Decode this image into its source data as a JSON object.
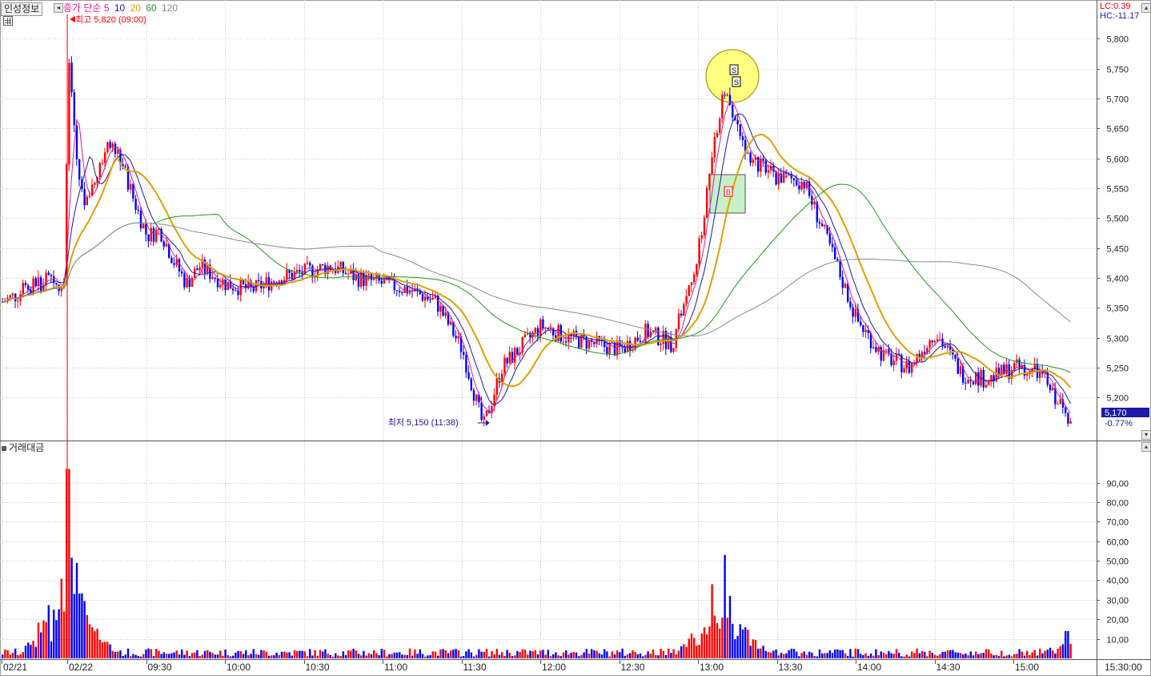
{
  "header": {
    "tab_label": "인성정보",
    "ma_title": "종가 단순",
    "ma_periods": [
      "5",
      "10",
      "20",
      "60",
      "120"
    ],
    "ma_colors": [
      "#e01a9a",
      "#1a1aa8",
      "#e0a000",
      "#1a9a1a",
      "#8a8a8a"
    ]
  },
  "annotations": {
    "high": "최고 5,820 (09:00)",
    "low": "최저 5,150 (11:38)",
    "lc": "LC:0.39",
    "hc": "HC:-11.17",
    "current_price": "5,170",
    "current_change": "-0.77%",
    "signals": [
      "S",
      "S",
      "B"
    ]
  },
  "volume_panel": {
    "title": "거래대금"
  },
  "colors": {
    "up": "#ff0000",
    "down": "#0000ff",
    "grid": "#c8c8c8",
    "signal_circle": "#ffff80",
    "signal_box": "#c8f0c8"
  },
  "chart_data": [
    {
      "type": "candlestick",
      "title": "인성정보",
      "ylim": [
        5120,
        5830
      ],
      "y_ticks": [
        "5,800",
        "5,750",
        "5,700",
        "5,650",
        "5,600",
        "5,550",
        "5,500",
        "5,450",
        "5,400",
        "5,350",
        "5,300",
        "5,250",
        "5,200"
      ],
      "x_ticks": [
        "02/21",
        "02/22",
        "09:30",
        "10:00",
        "10:30",
        "11:00",
        "11:30",
        "12:00",
        "12:30",
        "13:00",
        "13:30",
        "14:00",
        "14:30",
        "15:00",
        "15:30:00"
      ],
      "price_path": [
        [
          "02/21 15:00",
          5360
        ],
        [
          "02/21 15:20",
          5395
        ],
        [
          "02/21 15:30",
          5385
        ],
        [
          "09:00",
          5820
        ],
        [
          "09:03",
          5600
        ],
        [
          "09:06",
          5520
        ],
        [
          "09:10",
          5570
        ],
        [
          "09:15",
          5630
        ],
        [
          "09:20",
          5600
        ],
        [
          "09:25",
          5530
        ],
        [
          "09:30",
          5470
        ],
        [
          "09:35",
          5480
        ],
        [
          "09:40",
          5430
        ],
        [
          "09:45",
          5390
        ],
        [
          "09:50",
          5420
        ],
        [
          "10:00",
          5390
        ],
        [
          "10:10",
          5380
        ],
        [
          "10:20",
          5400
        ],
        [
          "10:30",
          5410
        ],
        [
          "10:40",
          5420
        ],
        [
          "10:50",
          5400
        ],
        [
          "11:00",
          5390
        ],
        [
          "11:10",
          5380
        ],
        [
          "11:20",
          5360
        ],
        [
          "11:30",
          5280
        ],
        [
          "11:38",
          5150
        ],
        [
          "11:45",
          5250
        ],
        [
          "12:00",
          5320
        ],
        [
          "12:10",
          5300
        ],
        [
          "12:20",
          5290
        ],
        [
          "12:30",
          5280
        ],
        [
          "12:40",
          5310
        ],
        [
          "12:50",
          5290
        ],
        [
          "13:00",
          5450
        ],
        [
          "13:05",
          5600
        ],
        [
          "13:10",
          5720
        ],
        [
          "13:15",
          5640
        ],
        [
          "13:20",
          5600
        ],
        [
          "13:25",
          5580
        ],
        [
          "13:30",
          5570
        ],
        [
          "13:40",
          5560
        ],
        [
          "13:50",
          5450
        ],
        [
          "14:00",
          5330
        ],
        [
          "14:10",
          5270
        ],
        [
          "14:20",
          5250
        ],
        [
          "14:30",
          5310
        ],
        [
          "14:40",
          5240
        ],
        [
          "14:50",
          5230
        ],
        [
          "15:00",
          5250
        ],
        [
          "15:10",
          5240
        ],
        [
          "15:20",
          5170
        ]
      ],
      "series": [
        {
          "name": "5",
          "color": "#e01a9a"
        },
        {
          "name": "10",
          "color": "#1a1aa8"
        },
        {
          "name": "20",
          "color": "#e0a000"
        },
        {
          "name": "60",
          "color": "#1a9a1a"
        },
        {
          "name": "120",
          "color": "#8a8a8a"
        }
      ]
    },
    {
      "type": "bar",
      "title": "거래대금",
      "ylim": [
        0,
        105
      ],
      "y_ticks": [
        "90,00",
        "80,00",
        "70,00",
        "60,00",
        "50,00",
        "40,00",
        "30,00",
        "20,00",
        "10,00"
      ],
      "volume_peaks": [
        [
          "09:00",
          97
        ],
        [
          "09:01",
          50
        ],
        [
          "09:02",
          33
        ],
        [
          "13:05",
          38
        ],
        [
          "13:10",
          53
        ],
        [
          "13:12",
          32
        ],
        [
          "15:20",
          14
        ]
      ],
      "baseline_level": 3
    }
  ]
}
